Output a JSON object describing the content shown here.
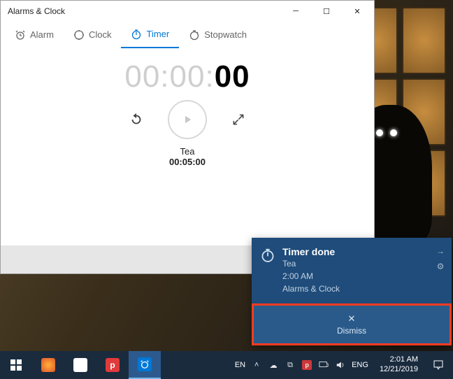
{
  "window": {
    "title": "Alarms & Clock",
    "tabs": [
      {
        "label": "Alarm"
      },
      {
        "label": "Clock"
      },
      {
        "label": "Timer"
      },
      {
        "label": "Stopwatch"
      }
    ],
    "active_tab_index": 2,
    "timer_display": {
      "grey": "00:00:",
      "black": "00"
    },
    "timer_name": "Tea",
    "timer_duration": "00:05:00"
  },
  "toast": {
    "title": "Timer done",
    "line1": "Tea",
    "line2": "2:00 AM",
    "app": "Alarms & Clock",
    "dismiss_label": "Dismiss"
  },
  "taskbar": {
    "lang_short": "EN",
    "lang_full": "ENG",
    "time": "2:01 AM",
    "date": "12/21/2019"
  }
}
